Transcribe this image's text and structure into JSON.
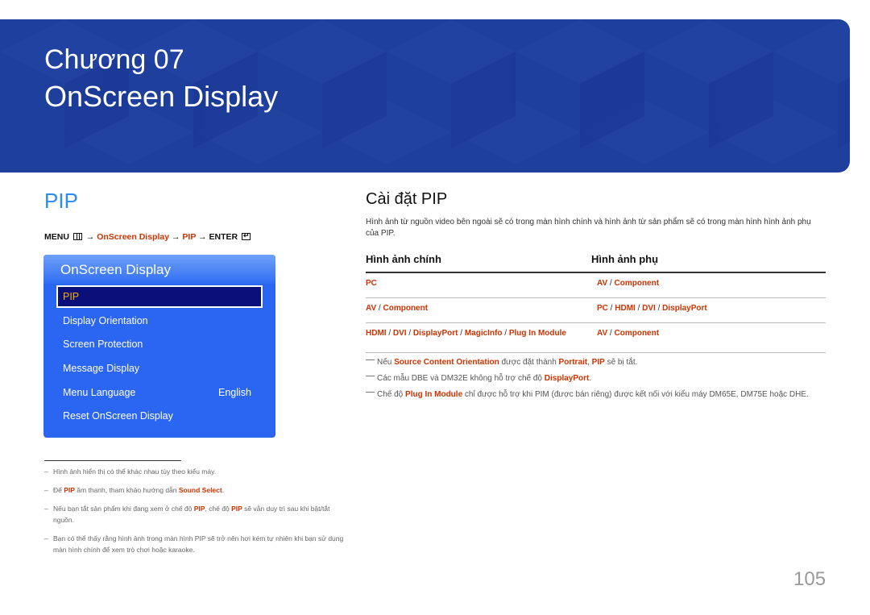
{
  "banner": {
    "chapter": "Chương 07",
    "title": "OnScreen Display",
    "bg_color": "#1f3f9c"
  },
  "left": {
    "section_title": "PIP",
    "menu_path": {
      "menu": "MENU",
      "menu_icon": "menu-grid-icon",
      "arrow": "→",
      "step1": "OnScreen Display",
      "step2": "PIP",
      "enter": "ENTER",
      "enter_icon": "enter-icon"
    },
    "osd": {
      "header": "OnScreen Display",
      "items": [
        {
          "label": "PIP",
          "value": "",
          "selected": true
        },
        {
          "label": "Display Orientation",
          "value": ""
        },
        {
          "label": "Screen Protection",
          "value": ""
        },
        {
          "label": "Message Display",
          "value": ""
        },
        {
          "label": "Menu Language",
          "value": "English"
        },
        {
          "label": "Reset OnScreen Display",
          "value": ""
        }
      ]
    },
    "notes": {
      "dash": "–",
      "n1": "Hình ảnh hiển thị có thể khác nhau tùy theo kiểu máy.",
      "n2_a": "Để ",
      "n2_b": "PIP",
      "n2_c": " âm thanh, tham khảo hướng dẫn ",
      "n2_d": "Sound Select",
      "n2_e": ".",
      "n3_a": "Nếu bạn tắt sản phẩm khi đang xem ở chế độ ",
      "n3_b": "PIP",
      "n3_c": ", chế độ ",
      "n3_d": "PIP",
      "n3_e": " sẽ vẫn duy trì sau khi bật/tắt nguồn.",
      "n4": "Bạn có thể thấy rằng hình ảnh trong màn hình PIP sẽ trở nên hơi kém tự nhiên khi bạn sử dụng màn hình chính để xem trò chơi hoặc karaoke."
    }
  },
  "right": {
    "title": "Cài đặt PIP",
    "description": "Hình ảnh từ nguồn video bên ngoài sẽ có trong màn hình chính và hình ảnh từ sản phẩm sẽ có trong màn hình hình ảnh phụ của PIP.",
    "table": {
      "headers": [
        "Hình ảnh chính",
        "Hình ảnh phụ"
      ],
      "sep": " / ",
      "rows": [
        {
          "main": [
            "PC"
          ],
          "sub": [
            "AV",
            "Component"
          ]
        },
        {
          "main": [
            "AV",
            "Component"
          ],
          "sub": [
            "PC",
            "HDMI",
            "DVI",
            "DisplayPort"
          ]
        },
        {
          "main": [
            "HDMI",
            "DVI",
            "DisplayPort",
            "MagicInfo",
            "Plug In Module"
          ],
          "sub": [
            "AV",
            "Component"
          ]
        }
      ]
    },
    "notes": {
      "n1_a": "Nếu ",
      "n1_b": "Source Content Orientation",
      "n1_c": " được đặt thành ",
      "n1_d": "Portrait",
      "n1_e": ", ",
      "n1_f": "PIP",
      "n1_g": " sẽ bị tắt.",
      "n2_a": "Các mẫu DBE và DM32E không hỗ trợ chế độ ",
      "n2_b": "DisplayPort",
      "n2_c": ".",
      "n3_a": "Chế độ ",
      "n3_b": "Plug In Module",
      "n3_c": " chỉ được hỗ trợ khi PIM (được bán riêng) được kết nối với kiểu máy DM65E, DM75E hoặc DHE."
    }
  },
  "page_number": "105",
  "colors": {
    "accent_blue": "#2d8cf0",
    "highlight_red": "#cc3300",
    "osd_blue": "#2b66f2",
    "osd_selected": "#0a0f7a",
    "osd_selected_text": "#f2b400"
  }
}
